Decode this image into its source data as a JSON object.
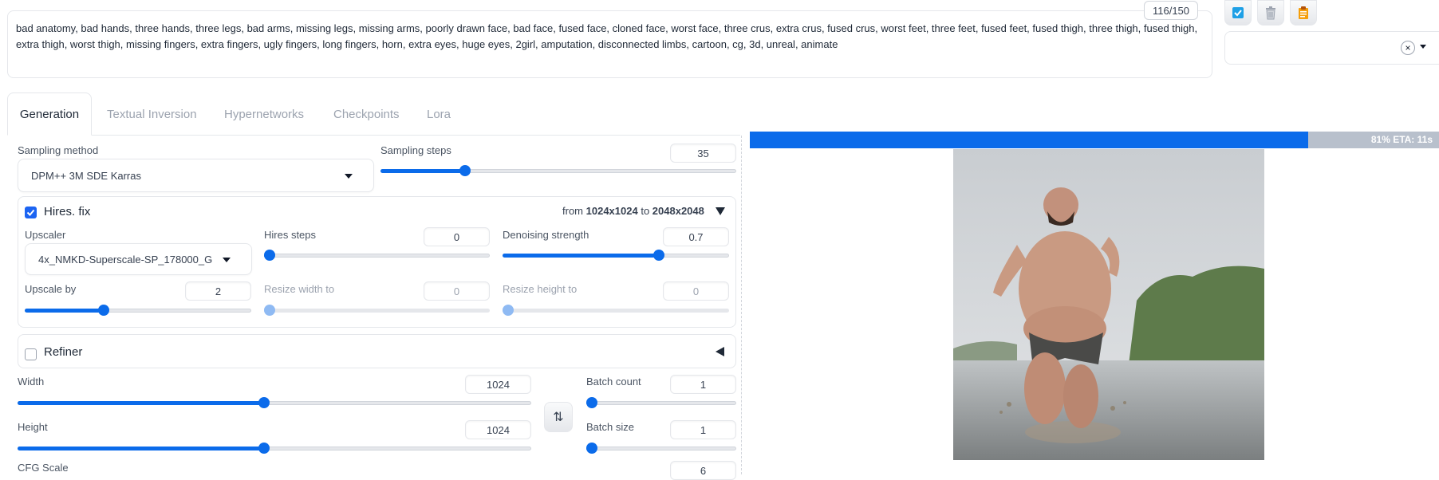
{
  "negative_prompt": {
    "text": "bad anatomy, bad hands, three hands, three legs, bad arms, missing legs, missing arms, poorly drawn face, bad face, fused face, cloned face, worst face, three crus, extra crus, fused crus, worst feet, three feet, fused feet, fused thigh, three thigh, fused thigh, extra thigh, worst thigh, missing fingers, extra fingers, ugly fingers, long fingers, horn, extra eyes, huge eyes, 2girl, amputation, disconnected limbs, cartoon, cg, 3d, unreal, animate",
    "token_count": "116/150"
  },
  "toolbar": {
    "icons": [
      "apply-styles-icon",
      "trash-icon",
      "clipboard-icon"
    ],
    "style_clear": "×"
  },
  "tabs": [
    {
      "label": "Generation",
      "active": true
    },
    {
      "label": "Textual Inversion",
      "active": false
    },
    {
      "label": "Hypernetworks",
      "active": false
    },
    {
      "label": "Checkpoints",
      "active": false
    },
    {
      "label": "Lora",
      "active": false
    }
  ],
  "sampling": {
    "method_label": "Sampling method",
    "method_value": "DPM++ 3M SDE Karras",
    "steps_label": "Sampling steps",
    "steps_value": "35",
    "steps_fraction": 0.23
  },
  "hires": {
    "label": "Hires. fix",
    "checked": true,
    "from_prefix": "from",
    "from_size": "1024x1024",
    "to_prefix": "to",
    "to_size": "2048x2048",
    "upscaler_label": "Upscaler",
    "upscaler_value": "4x_NMKD-Superscale-SP_178000_G",
    "hires_steps_label": "Hires steps",
    "hires_steps_value": "0",
    "hires_steps_fraction": 0.0,
    "denoising_label": "Denoising strength",
    "denoising_value": "0.7",
    "denoising_fraction": 0.7,
    "upscale_by_label": "Upscale by",
    "upscale_by_value": "2",
    "upscale_by_fraction": 0.34,
    "resize_width_label": "Resize width to",
    "resize_width_value": "0",
    "resize_height_label": "Resize height to",
    "resize_height_value": "0"
  },
  "refiner": {
    "label": "Refiner",
    "checked": false
  },
  "size": {
    "width_label": "Width",
    "width_value": "1024",
    "width_fraction": 0.48,
    "height_label": "Height",
    "height_value": "1024",
    "height_fraction": 0.48,
    "swap_glyph": "⇅"
  },
  "batch": {
    "count_label": "Batch count",
    "count_value": "1",
    "count_fraction": 0.0,
    "size_label": "Batch size",
    "size_value": "1",
    "size_fraction": 0.0
  },
  "cfg": {
    "label": "CFG Scale",
    "value": "6"
  },
  "progress": {
    "percent": 81,
    "text": "81% ETA: 11s"
  },
  "colors": {
    "accent": "#0b6bea",
    "progress_remaining": "#b8c0cc"
  }
}
